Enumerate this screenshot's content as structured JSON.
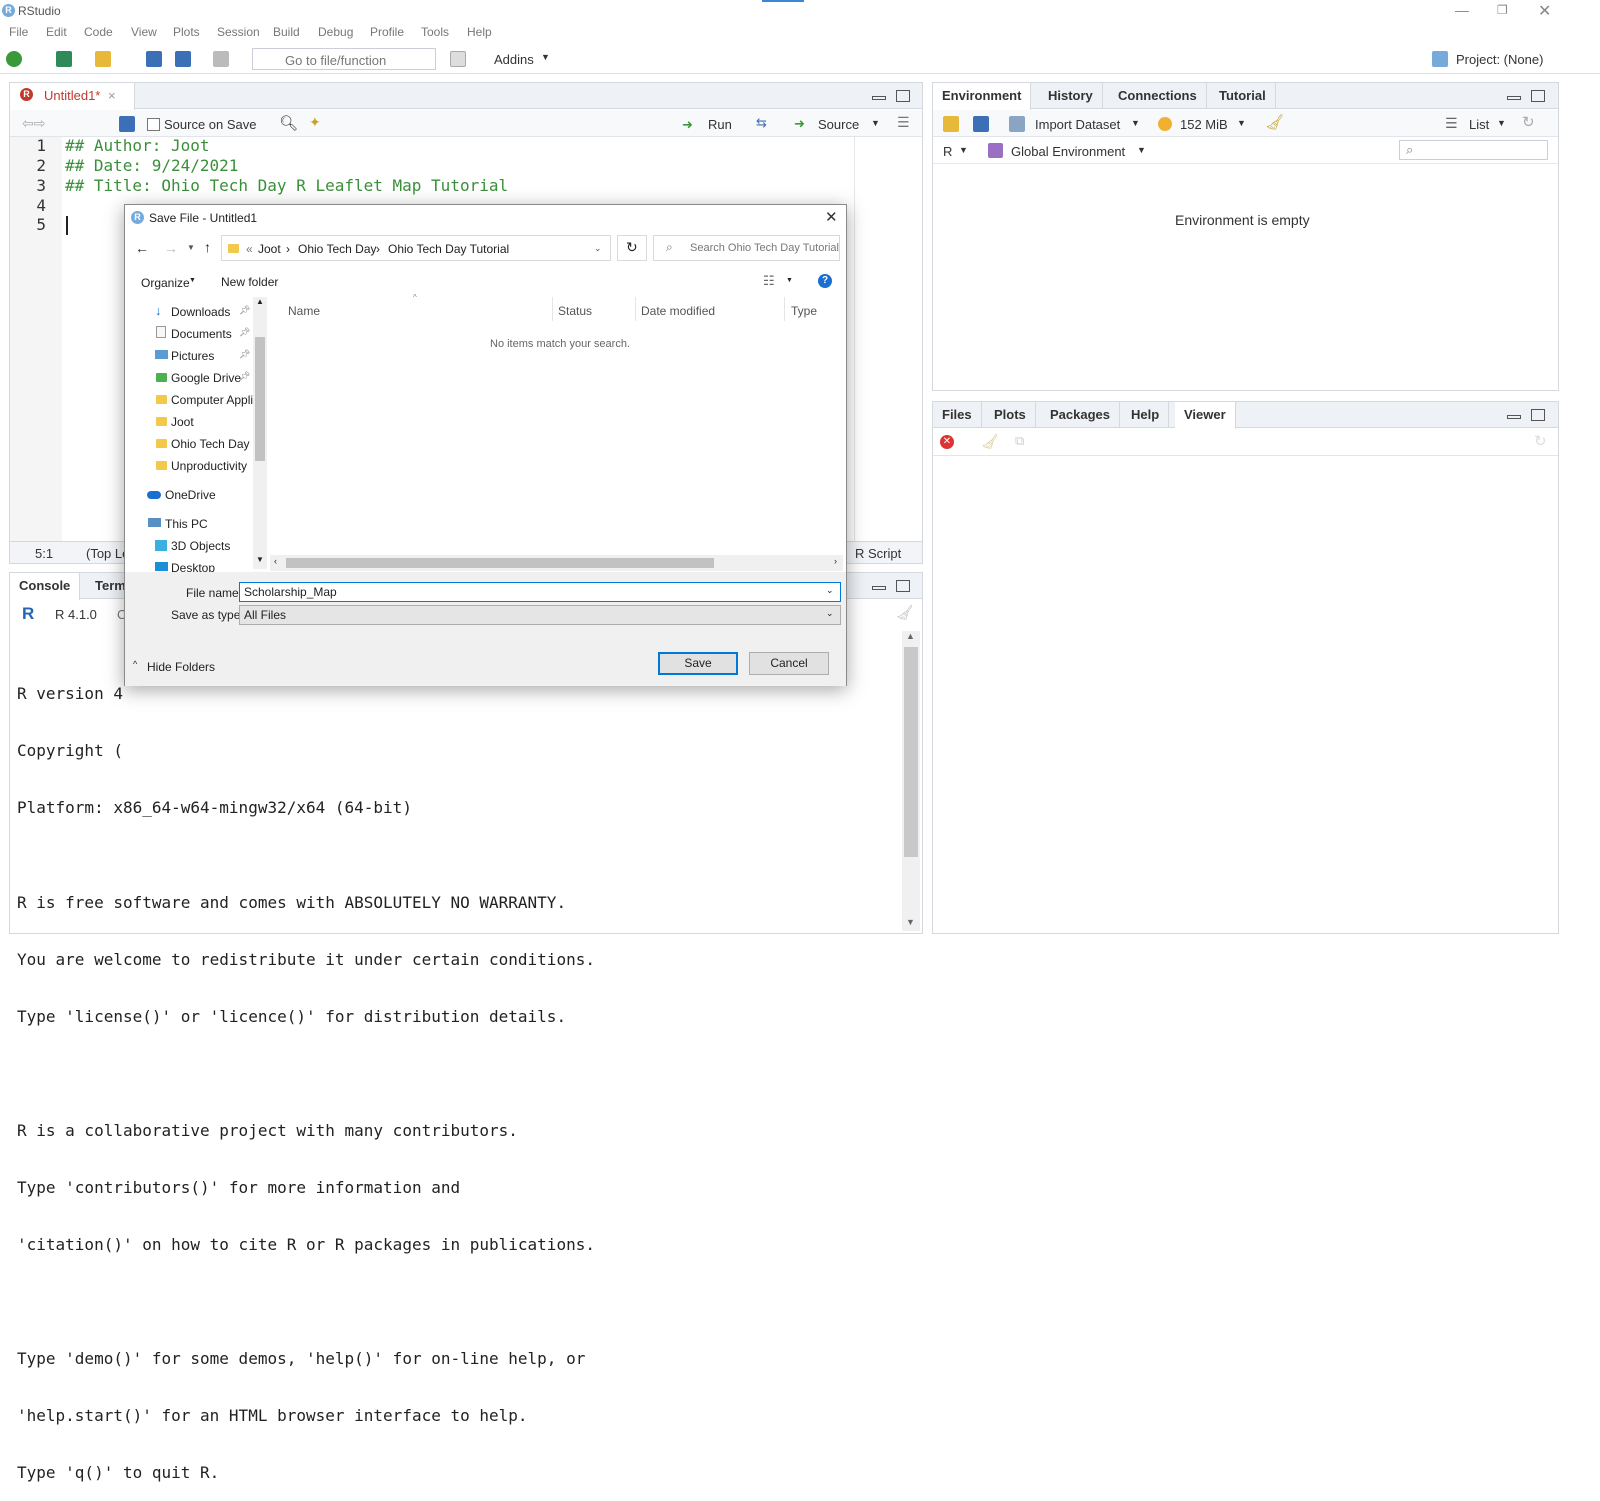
{
  "app": {
    "title": "RStudio"
  },
  "menu": [
    "File",
    "Edit",
    "Code",
    "View",
    "Plots",
    "Session",
    "Build",
    "Debug",
    "Profile",
    "Tools",
    "Help"
  ],
  "toolbar": {
    "goto_placeholder": "Go to file/function",
    "addins": "Addins",
    "project": "Project: (None)"
  },
  "editor": {
    "tab_label": "Untitled1*",
    "source_on_save": "Source on Save",
    "run": "Run",
    "source": "Source",
    "lines": [
      {
        "n": "1",
        "text": "## Author: Joot"
      },
      {
        "n": "2",
        "text": "## Date: 9/24/2021"
      },
      {
        "n": "3",
        "text": "## Title: Ohio Tech Day R Leaflet Map Tutorial"
      },
      {
        "n": "4",
        "text": ""
      },
      {
        "n": "5",
        "text": ""
      }
    ],
    "status_pos": "5:1",
    "status_scope": "(Top Le",
    "status_type": "R Script"
  },
  "console": {
    "tabs": [
      "Console",
      "Term"
    ],
    "version": "R 4.1.0",
    "path_frag": "C",
    "lines": [
      "R version 4",
      "Copyright (",
      "Platform: x86_64-w64-mingw32/x64 (64-bit)",
      "",
      "R is free software and comes with ABSOLUTELY NO WARRANTY.",
      "You are welcome to redistribute it under certain conditions.",
      "Type 'license()' or 'licence()' for distribution details.",
      "",
      "R is a collaborative project with many contributors.",
      "Type 'contributors()' for more information and",
      "'citation()' on how to cite R or R packages in publications.",
      "",
      "Type 'demo()' for some demos, 'help()' for on-line help, or",
      "'help.start()' for an HTML browser interface to help.",
      "Type 'q()' to quit R."
    ]
  },
  "env": {
    "tabs": [
      "Environment",
      "History",
      "Connections",
      "Tutorial"
    ],
    "import": "Import Dataset",
    "memory": "152 MiB",
    "list": "List",
    "lang": "R",
    "scope": "Global Environment",
    "empty": "Environment is empty"
  },
  "files": {
    "tabs": [
      "Files",
      "Plots",
      "Packages",
      "Help",
      "Viewer"
    ]
  },
  "dialog": {
    "title": "Save File - Untitled1",
    "crumbs": [
      "«",
      "Joot",
      "Ohio Tech Day",
      "Ohio Tech Day Tutorial"
    ],
    "search_placeholder": "Search Ohio Tech Day Tutorial",
    "organize": "Organize",
    "new_folder": "New folder",
    "nav": [
      "Downloads",
      "Documents",
      "Pictures",
      "Google Drive",
      "Computer Applic",
      "Joot",
      "Ohio Tech Day",
      "Unproductivity",
      "OneDrive",
      "This PC",
      "3D Objects",
      "Desktop"
    ],
    "columns": [
      "Name",
      "Status",
      "Date modified",
      "Type"
    ],
    "empty": "No items match your search.",
    "filename_label": "File name:",
    "filename": "Scholarship_Map",
    "type_label": "Save as type:",
    "type": "All Files",
    "hide_folders": "Hide Folders",
    "save": "Save",
    "cancel": "Cancel"
  }
}
